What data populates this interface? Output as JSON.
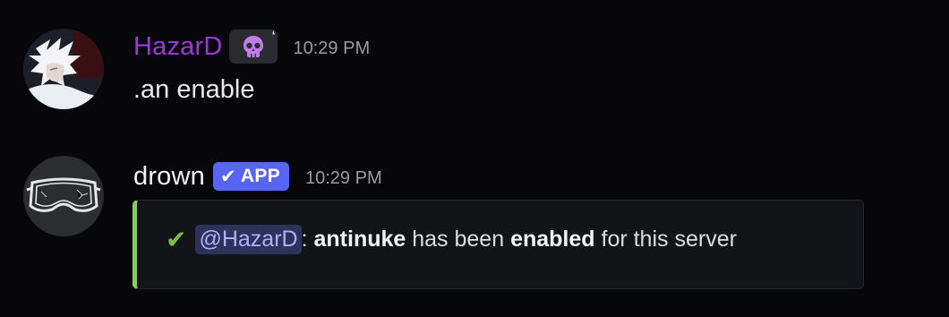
{
  "messages": [
    {
      "author": "HazarD",
      "role_icon": "skull-icon",
      "timestamp": "10:29 PM",
      "content": ".an enable",
      "name_color": "#9b38d8"
    },
    {
      "author": "drown",
      "badge": {
        "check": "✔",
        "label": "APP"
      },
      "timestamp": "10:29 PM",
      "embed": {
        "accent_color": "#8bc76a",
        "check_glyph": "✔",
        "mention": "@HazarD",
        "sep": ": ",
        "bold1": "antinuke",
        "text1": " has been ",
        "bold2": "enabled",
        "text2": " for this server"
      }
    }
  ]
}
